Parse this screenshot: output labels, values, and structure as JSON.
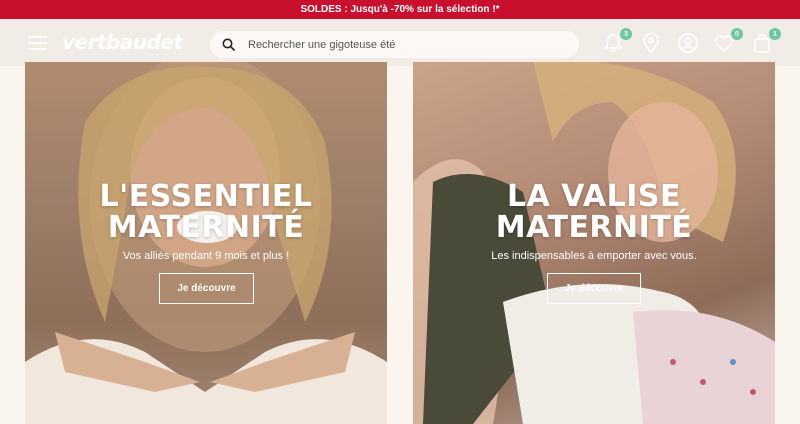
{
  "promo": {
    "text": "SOLDES : Jusqu'à -70% sur la sélection !*"
  },
  "header": {
    "logo": "vertbaudet",
    "search_placeholder": "Rechercher une gigoteuse été",
    "icons": {
      "notifications_badge": "3",
      "wishlist_badge": "0",
      "cart_badge": "1"
    }
  },
  "cards": [
    {
      "title_line1": "L'ESSENTIEL",
      "title_line2": "MATERNITÉ",
      "subtitle": "Vos alliés pendant 9 mois et plus !",
      "button": "Je découvre"
    },
    {
      "title_line1": "LA VALISE",
      "title_line2": "MATERNITÉ",
      "subtitle": "Les indispensables à emporter avec vous.",
      "button": "Je découvre"
    }
  ],
  "colors": {
    "promo_bg": "#c8102e",
    "header_bg": "#f1ece6",
    "badge": "#6fc7a4",
    "page_bg": "#fbf5ef"
  }
}
